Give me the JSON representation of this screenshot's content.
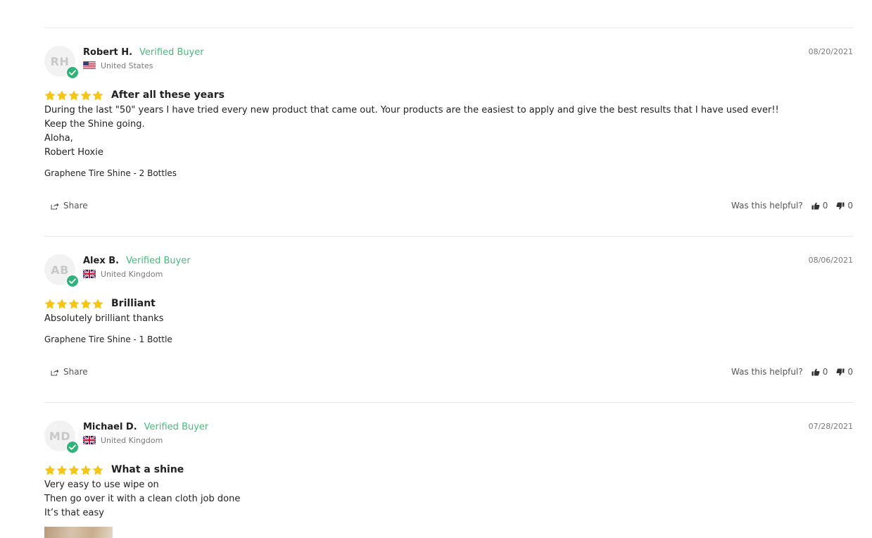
{
  "reviews": [
    {
      "initials": "RH",
      "name": "Robert H.",
      "verified_label": "Verified Buyer",
      "country": "United States",
      "flag": "us-flag-icon",
      "date": "08/20/2021",
      "rating": 5,
      "title": "After all these years",
      "body": [
        "During the last \"50\" years I have tried every new product that came out. Your products are the easiest to apply and give the best results that I have used ever!!",
        "Keep the Shine going.",
        "Aloha,",
        "Robert Hoxie"
      ],
      "product": "Graphene Tire Shine - 2 Bottles",
      "share_label": "Share",
      "helpful_label": "Was this helpful?",
      "thumbs_up": "0",
      "thumbs_down": "0"
    },
    {
      "initials": "AB",
      "name": "Alex B.",
      "verified_label": "Verified Buyer",
      "country": "United Kingdom",
      "flag": "uk-flag-icon",
      "date": "08/06/2021",
      "rating": 5,
      "title": "Brilliant",
      "body": [
        "Absolutely brilliant thanks"
      ],
      "product": "Graphene Tire Shine - 1 Bottle",
      "share_label": "Share",
      "helpful_label": "Was this helpful?",
      "thumbs_up": "0",
      "thumbs_down": "0"
    },
    {
      "initials": "MD",
      "name": "Michael D.",
      "verified_label": "Verified Buyer",
      "country": "United Kingdom",
      "flag": "uk-flag-icon",
      "date": "07/28/2021",
      "rating": 5,
      "title": "What a shine",
      "body": [
        "Very easy to use wipe on",
        "Then go over it with a clean cloth job done",
        "It’s that easy"
      ]
    }
  ],
  "colors": {
    "star": "#f5c518",
    "verified": "#48b97c",
    "badge": "#2fb37a",
    "divider": "#e6e6e6"
  },
  "icons": {
    "share": "share-icon",
    "thumbs_up": "thumbs-up-icon",
    "thumbs_down": "thumbs-down-icon",
    "star": "star-icon",
    "verified": "checkmark-icon"
  }
}
